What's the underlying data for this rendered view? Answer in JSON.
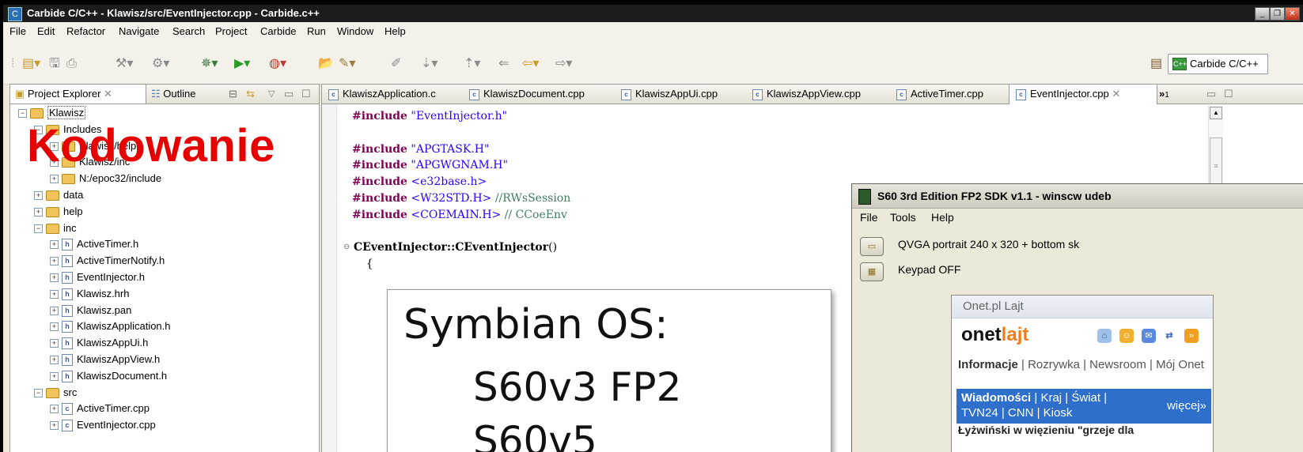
{
  "window": {
    "title": "Carbide C/C++ - Klawisz/src/EventInjector.cpp - Carbide.c++"
  },
  "menubar": [
    "File",
    "Edit",
    "Refactor",
    "Navigate",
    "Search",
    "Project",
    "Carbide",
    "Run",
    "Window",
    "Help"
  ],
  "toolbar": {
    "perspective_label": "Carbide C/C++"
  },
  "left_pane": {
    "tabs": [
      "Project Explorer",
      "Outline"
    ],
    "tree": [
      {
        "label": "Klawisz",
        "level": 0,
        "kind": "project",
        "expanded": true
      },
      {
        "label": "Includes",
        "level": 1,
        "kind": "folder",
        "expanded": true
      },
      {
        "label": "Klawisz/help",
        "level": 2,
        "kind": "folder",
        "expanded": false
      },
      {
        "label": "Klawisz/inc",
        "level": 2,
        "kind": "folder",
        "expanded": false
      },
      {
        "label": "N:/epoc32/include",
        "level": 2,
        "kind": "folder",
        "expanded": false
      },
      {
        "label": "data",
        "level": 1,
        "kind": "folder",
        "expanded": false
      },
      {
        "label": "help",
        "level": 1,
        "kind": "folder",
        "expanded": false
      },
      {
        "label": "inc",
        "level": 1,
        "kind": "folder",
        "expanded": true
      },
      {
        "label": "ActiveTimer.h",
        "level": 2,
        "kind": "h"
      },
      {
        "label": "ActiveTimerNotify.h",
        "level": 2,
        "kind": "h"
      },
      {
        "label": "EventInjector.h",
        "level": 2,
        "kind": "h"
      },
      {
        "label": "Klawisz.hrh",
        "level": 2,
        "kind": "h"
      },
      {
        "label": "Klawisz.pan",
        "level": 2,
        "kind": "h"
      },
      {
        "label": "KlawiszApplication.h",
        "level": 2,
        "kind": "h"
      },
      {
        "label": "KlawiszAppUi.h",
        "level": 2,
        "kind": "h"
      },
      {
        "label": "KlawiszAppView.h",
        "level": 2,
        "kind": "h"
      },
      {
        "label": "KlawiszDocument.h",
        "level": 2,
        "kind": "h"
      },
      {
        "label": "src",
        "level": 1,
        "kind": "folder",
        "expanded": true
      },
      {
        "label": "ActiveTimer.cpp",
        "level": 2,
        "kind": "c"
      },
      {
        "label": "EventInjector.cpp",
        "level": 2,
        "kind": "c"
      }
    ],
    "overlay_title": "Kodowanie"
  },
  "editor": {
    "tabs": [
      "KlawiszApplication.c",
      "KlawiszDocument.cpp",
      "KlawiszAppUi.cpp",
      "KlawiszAppView.cpp",
      "ActiveTimer.cpp",
      "EventInjector.cpp"
    ],
    "active_tab": "EventInjector.cpp",
    "overflow_count": "1",
    "code": [
      {
        "kw": "#include",
        "rest": " \"EventInjector.h\"",
        "type": "str"
      },
      {
        "kw": "",
        "rest": "",
        "type": "blank"
      },
      {
        "kw": "#include",
        "rest": " \"APGTASK.H\"",
        "type": "str"
      },
      {
        "kw": "#include",
        "rest": " \"APGWGNAM.H\"",
        "type": "str"
      },
      {
        "kw": "#include",
        "rest": " <e32base.h>",
        "type": "str"
      },
      {
        "kw": "#include",
        "rest": " <W32STD.H>",
        "comment": " //RWsSession",
        "type": "str"
      },
      {
        "kw": "#include",
        "rest": " <COEMAIN.H>",
        "comment": " // CCoeEnv",
        "type": "str"
      },
      {
        "kw": "",
        "rest": "",
        "type": "blank"
      },
      {
        "kw": "CEventInjector::CEventInjector",
        "rest": "()",
        "type": "fn"
      },
      {
        "kw": "",
        "rest": "    {",
        "type": "plain"
      }
    ]
  },
  "slide": {
    "line1": "Symbian OS:",
    "line2": "S60v3 FP2",
    "line3": "S60v5"
  },
  "emulator": {
    "title": "S60 3rd Edition FP2 SDK v1.1 - winscw udeb",
    "menu": [
      "File",
      "Tools",
      "Help"
    ],
    "rows": [
      "QVGA portrait 240 x 320 + bottom sk",
      "Keypad OFF"
    ],
    "phone": {
      "header": "Onet.pl Lajt",
      "logo_a": "onet",
      "logo_b": "lajt",
      "links_bold": "Informacje",
      "links_rest": " | Rozrywka | Newsroom | Mój Onet",
      "news_bold": "Wiadomości",
      "news_rest": " | Kraj | Świat |",
      "news_line2": "TVN24 | CNN | Kiosk",
      "news_more": "więcej»",
      "last_line": "Łyżwiński w więzieniu \"grzeje dla"
    }
  }
}
